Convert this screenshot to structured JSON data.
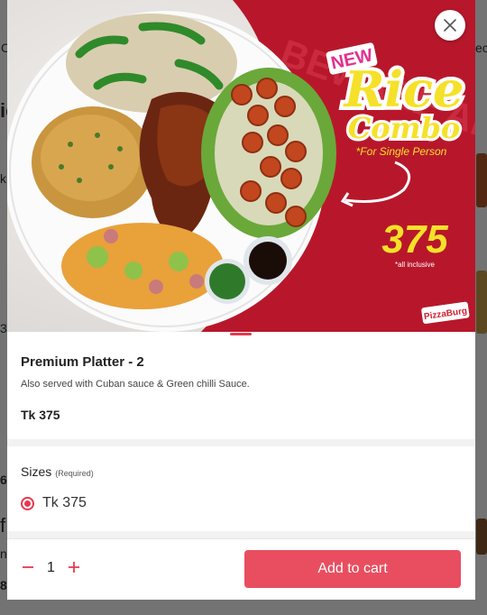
{
  "background": {
    "fragments": [
      "C",
      "ec",
      "ie",
      "k",
      "3",
      "6",
      "f",
      "n",
      "8"
    ]
  },
  "hero": {
    "badge": "NEW",
    "title_line1": "Rice",
    "title_line2": "Combo",
    "subtitle": "*For Single Person",
    "price": "375",
    "price_note": "*all inclusive",
    "brand": "PizzaBurg",
    "watermark": "BEWARE ADDICTIVE"
  },
  "product": {
    "title": "Premium Platter - 2",
    "description": "Also served with Cuban sauce & Green chilli Sauce.",
    "price": "Tk 375"
  },
  "sizes": {
    "title": "Sizes",
    "required": "(Required)",
    "options": [
      {
        "label": "Tk 375",
        "selected": true
      }
    ]
  },
  "footer": {
    "quantity": "1",
    "minus": "−",
    "plus": "+",
    "add_label": "Add to cart"
  },
  "colors": {
    "accent": "#e8384f",
    "button": "#e84e5f",
    "poster_red": "#b8172b",
    "poster_yellow": "#f5e12a"
  }
}
